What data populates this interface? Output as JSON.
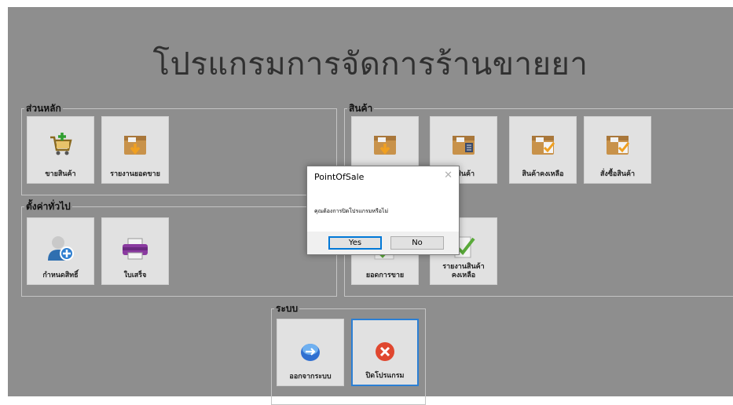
{
  "app": {
    "title": "โปรแกรมการจัดการร้านขายยา"
  },
  "groups": {
    "main": {
      "legend": "ส่วนหลัก",
      "tiles": [
        {
          "label": "ขายสินค้า",
          "icon": "shopping-cart-add-icon"
        },
        {
          "label": "รายงานยอดขาย",
          "icon": "box-download-icon"
        }
      ]
    },
    "product": {
      "legend": "สินค้า",
      "tiles": [
        {
          "label": "",
          "icon": "box-download-icon"
        },
        {
          "label": "ข้อมูลสินค้า",
          "label_visible": "ูลสินค้า",
          "icon": "box-list-icon"
        },
        {
          "label": "สินค้าคงเหลือ",
          "icon": "box-check-icon"
        },
        {
          "label": "สั่งซื้อสินค้า",
          "icon": "box-check-icon"
        },
        {
          "label": "ยอดการขาย",
          "icon": "check-icon"
        },
        {
          "label": "รายงานสินค้า\nคงเหลือ",
          "line1": "รายงานสินค้า",
          "line2": "คงเหลือ",
          "icon": "report-check-icon"
        }
      ]
    },
    "settings": {
      "legend": "ตั้งค่าทั่วไป",
      "tiles": [
        {
          "label": "กำหนดสิทธิ์",
          "icon": "user-add-icon"
        },
        {
          "label": "ใบเสร็จ",
          "icon": "printer-icon"
        }
      ]
    },
    "system": {
      "legend": "ระบบ",
      "tiles": [
        {
          "label": "ออกจากระบบ",
          "icon": "logout-icon"
        },
        {
          "label": "ปิดโปรแกรม",
          "icon": "close-circle-icon"
        }
      ]
    }
  },
  "dialog": {
    "title": "PointOfSale",
    "close_glyph": "✕",
    "message": "คุณต้องการปิดโปรแกรมหรือไม่",
    "yes_label": "Yes",
    "no_label": "No"
  },
  "colors": {
    "background": "#8e8e8e",
    "tile": "#e1e1e1",
    "selected_border": "#2b7fd4"
  }
}
